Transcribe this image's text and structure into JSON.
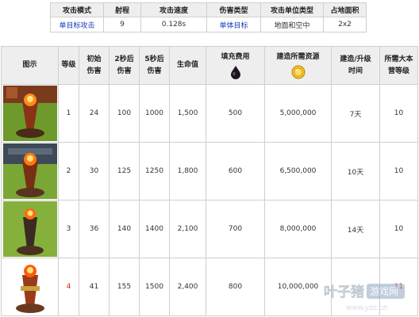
{
  "info_table": {
    "headers": [
      "攻击模式",
      "射程",
      "攻击速度",
      "伤害类型",
      "攻击单位类型",
      "占地面积"
    ],
    "values": [
      "单目标攻击",
      "9",
      "0.128s",
      "单体目标",
      "地面和空中",
      "2x2"
    ]
  },
  "main_table": {
    "headers": {
      "image": "图示",
      "level": "等级",
      "initial_damage_1": "初始",
      "initial_damage_2": "伤害",
      "damage_2s_1": "2秒后",
      "damage_2s_2": "伤害",
      "damage_5s_1": "5秒后",
      "damage_5s_2": "伤害",
      "hp": "生命值",
      "refill_cost": "填充费用",
      "build_cost": "建造所需资源",
      "build_time_1": "建造/升级",
      "build_time_2": "时间",
      "th_level_1": "所需大本",
      "th_level_2": "营等级"
    },
    "rows": [
      {
        "level": "1",
        "initial": "24",
        "d2": "100",
        "d5": "1000",
        "hp": "1,500",
        "refill": "500",
        "cost": "5,000,000",
        "time": "7天",
        "th": "10"
      },
      {
        "level": "2",
        "initial": "30",
        "d2": "125",
        "d5": "1250",
        "hp": "1,800",
        "refill": "600",
        "cost": "6,500,000",
        "time": "10天",
        "th": "10"
      },
      {
        "level": "3",
        "initial": "36",
        "d2": "140",
        "d5": "1400",
        "hp": "2,100",
        "refill": "700",
        "cost": "8,000,000",
        "time": "14天",
        "th": "10"
      },
      {
        "level": "4",
        "initial": "41",
        "d2": "155",
        "d5": "1500",
        "hp": "2,400",
        "refill": "800",
        "cost": "10,000,000",
        "time": "",
        "th": "11"
      }
    ]
  },
  "icons": {
    "refill": "dark-elixir-drop-icon",
    "cost": "gold-coin-icon"
  },
  "colors": {
    "link_blue": "#1a3bb8",
    "highlight_red": "#d42a2a",
    "header_bg": "#eeeeee",
    "border": "#cfcfcf"
  },
  "watermark": {
    "brand": "叶子猪",
    "badge": "游戏网",
    "url": "www.yzz.cn"
  }
}
